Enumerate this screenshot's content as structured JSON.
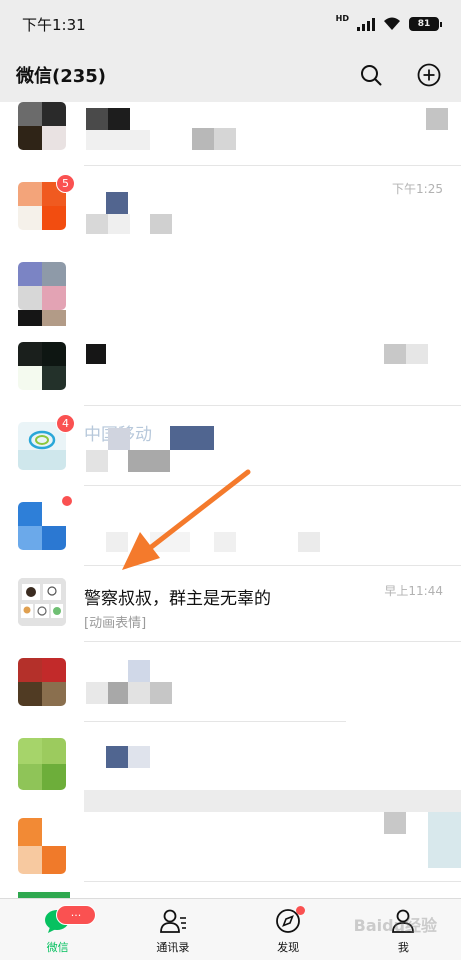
{
  "status_bar": {
    "time": "下午1:31",
    "network": "HD",
    "battery": "81"
  },
  "header": {
    "title": "微信(235)"
  },
  "chats": [
    {
      "time": "",
      "title": "",
      "preview": ""
    },
    {
      "time": "下午1:25",
      "title": "",
      "preview": "",
      "badge": "5"
    },
    {
      "time": "",
      "title": "",
      "preview": ""
    },
    {
      "time": "",
      "title": "",
      "preview": ""
    },
    {
      "time": "",
      "title": "中国移动",
      "preview": "",
      "badge": "4"
    },
    {
      "time": "",
      "title": "",
      "preview": ""
    },
    {
      "time": "早上11:44",
      "title": "警察叔叔，群主是无辜的",
      "preview": "[动画表情]"
    },
    {
      "time": "",
      "title": "",
      "preview": ""
    },
    {
      "time": "",
      "title": "",
      "preview": ""
    },
    {
      "time": "",
      "title": "",
      "preview": ""
    }
  ],
  "tabs": [
    {
      "label": "微信",
      "badge": "···"
    },
    {
      "label": "通讯录"
    },
    {
      "label": "发现"
    },
    {
      "label": "我"
    }
  ],
  "watermark": "Baidu经验",
  "colors": {
    "accent": "#07c160",
    "badge": "#fa5151",
    "arrow": "#f47a2c"
  }
}
